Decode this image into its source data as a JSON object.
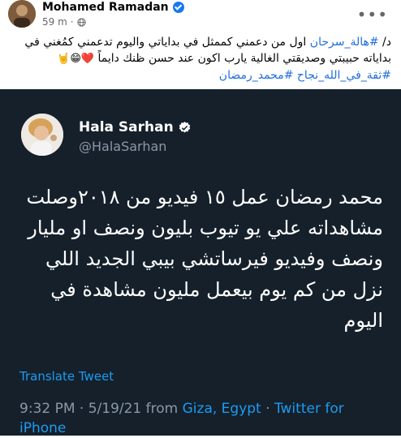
{
  "post": {
    "author": "Mohamed Ramadan",
    "time": "59 m",
    "separator": "·",
    "caption_prefix": "د/ ",
    "caption_tag1": "#هالة_سرحان",
    "caption_body": " اول من دعمني كممثل في بداياتي واليوم تدعمني كمُغني في بداياته حبيبتي وصديقتي الغالية يارب اكون عند حسن ظنك دايماً",
    "caption_emojis": "❤️😁🤘",
    "caption_tags2": "#ثقة_في_الله_نجاح #محمد_رمضان",
    "more_label": "•••"
  },
  "tweet": {
    "name": "Hala Sarhan",
    "handle": "@HalaSarhan",
    "text": "محمد رمضان عمل ١٥ فيديو من ٢٠١٨وصلت مشاهداته علي يو تيوب بليون ونصف او مليار ونصف  وفيديو فيرساتشي بيبي الجديد اللي نزل من كم يوم بيعمل مليون مشاهدة في اليوم",
    "translate": "Translate Tweet",
    "time": "9:32 PM · 5/19/21 from ",
    "location": "Giza, Egypt",
    "sep": " · ",
    "source": "Twitter for iPhone"
  },
  "colors": {
    "tweet_bg": "#15202b",
    "link": "#1d9bf0",
    "fb_blue": "#1877f2",
    "hashtag": "#216fdb"
  },
  "icons": [
    "verified-badge-icon",
    "globe-icon",
    "more-options-icon"
  ]
}
